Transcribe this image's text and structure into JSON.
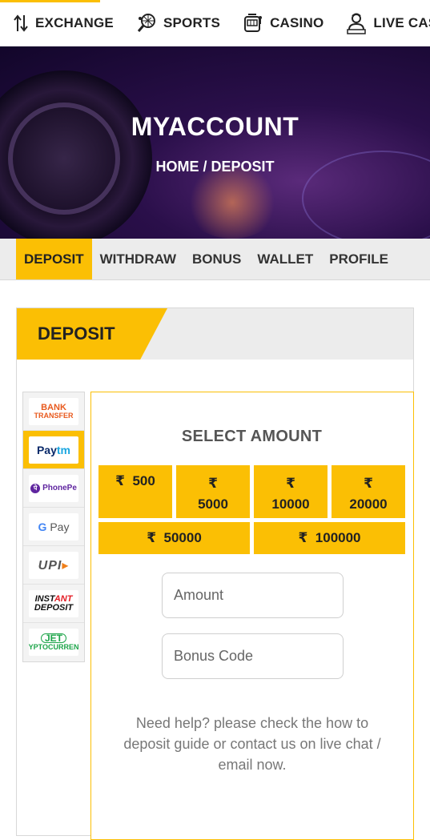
{
  "topnav": {
    "items": [
      {
        "label": "EXCHANGE",
        "icon": "exchange-arrows-icon"
      },
      {
        "label": "SPORTS",
        "icon": "tennis-racket-icon"
      },
      {
        "label": "CASINO",
        "icon": "slot-machine-icon"
      },
      {
        "label": "LIVE CASINO",
        "icon": "live-dealer-icon"
      }
    ]
  },
  "hero": {
    "title": "MYACCOUNT",
    "breadcrumb": "HOME / DEPOSIT"
  },
  "tabs": [
    {
      "label": "DEPOSIT",
      "active": true
    },
    {
      "label": "WITHDRAW"
    },
    {
      "label": "BONUS"
    },
    {
      "label": "WALLET"
    },
    {
      "label": "PROFILE"
    }
  ],
  "panel": {
    "title": "DEPOSIT"
  },
  "methods": [
    {
      "name": "bank-transfer",
      "line1": "BANK",
      "line2": "TRANSFER"
    },
    {
      "name": "paytm",
      "part1": "Pay",
      "part2": "tm",
      "active": true
    },
    {
      "name": "phonepe",
      "mark": "पे",
      "label": "PhonePe"
    },
    {
      "name": "gpay",
      "g": "G",
      "label": "Pay"
    },
    {
      "name": "upi",
      "label": "UPI"
    },
    {
      "name": "instant-deposit",
      "line1a": "INST",
      "line1b": "ANT",
      "line2": "DEPOSIT"
    },
    {
      "name": "jet-crypto",
      "line1": "JET",
      "line2": "CRYPTOCURRENCY"
    }
  ],
  "amount": {
    "title": "SELECT AMOUNT",
    "currency_symbol": "₹",
    "options": [
      "500",
      "5000",
      "10000",
      "20000",
      "50000",
      "100000"
    ],
    "amount_placeholder": "Amount",
    "bonus_placeholder": "Bonus Code",
    "help_text": "Need help? please check the how to deposit guide or contact us on live chat / email now."
  },
  "colors": {
    "accent": "#fbbf04",
    "tab_bg": "#ececec",
    "text_dark": "#222222",
    "help_text": "#777777"
  }
}
